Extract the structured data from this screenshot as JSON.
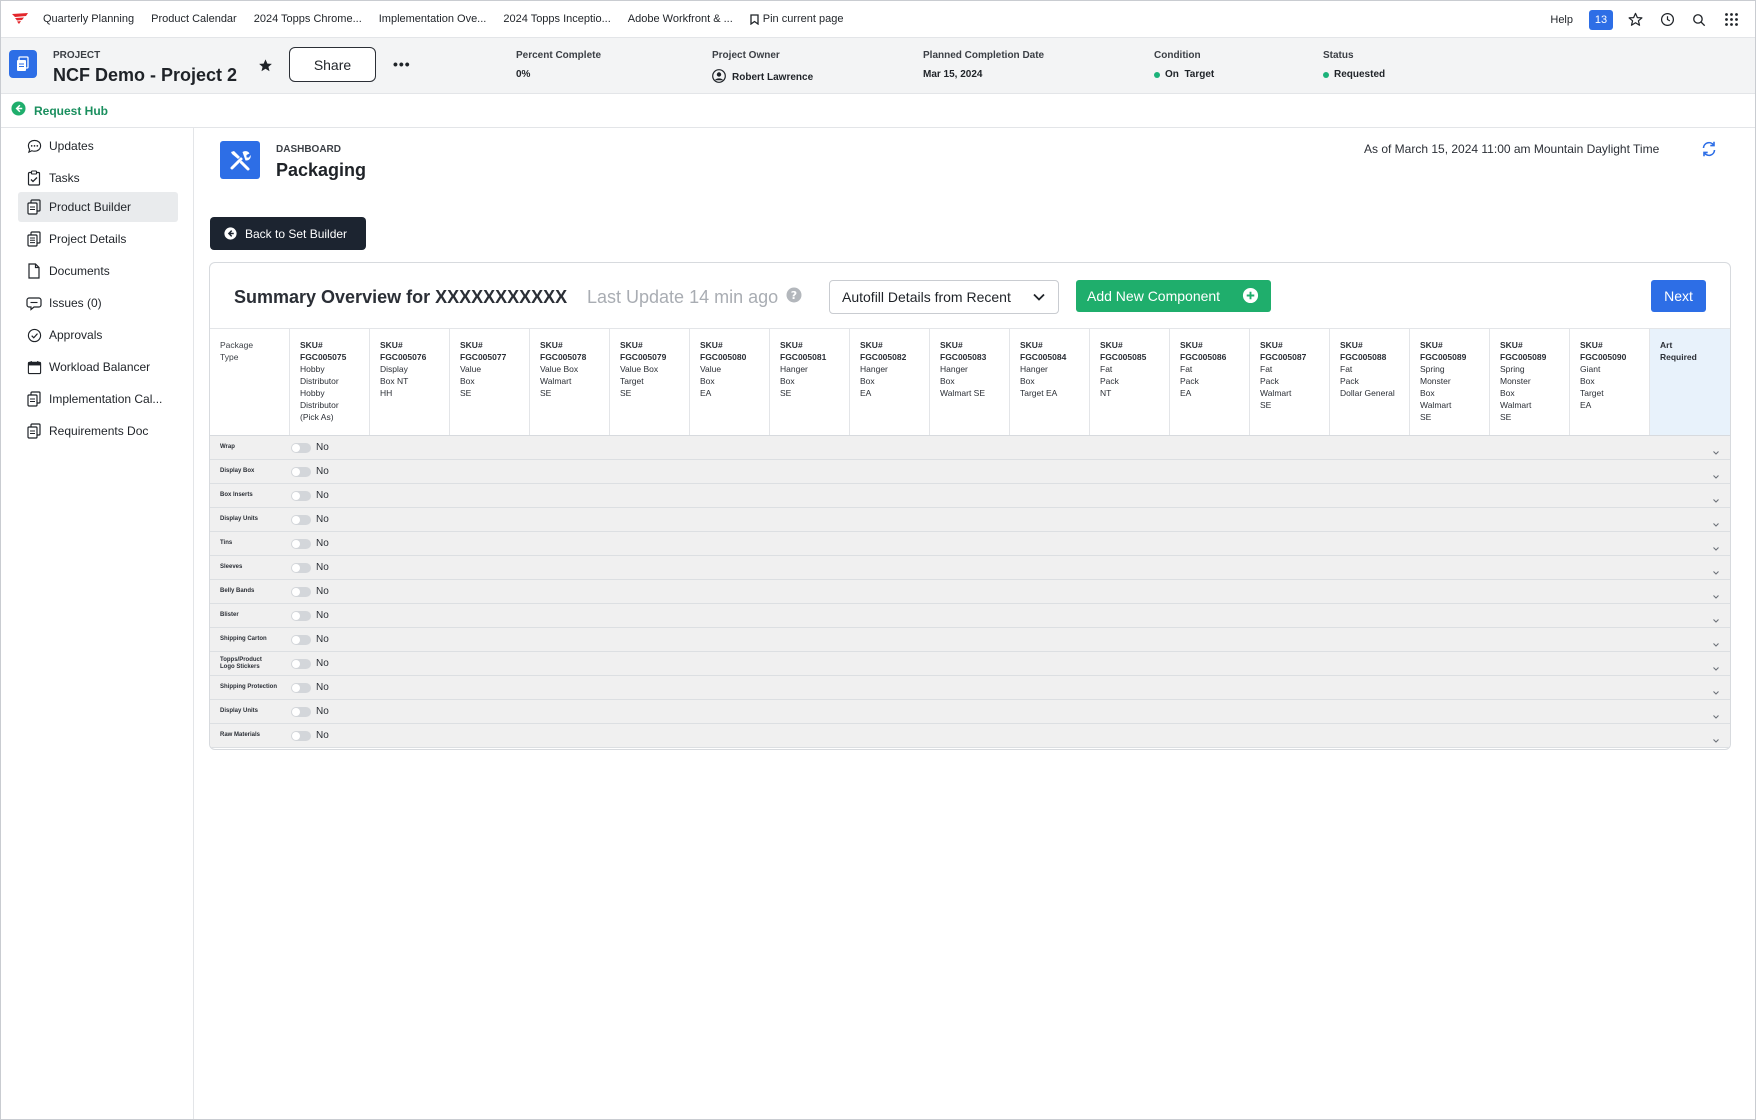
{
  "topbar": {
    "links": [
      "Quarterly Planning",
      "Product Calendar",
      "2024 Topps Chrome...",
      "Implementation Ove...",
      "2024 Topps Inceptio...",
      "Adobe Workfront & ..."
    ],
    "pin_label": "Pin current page",
    "help_label": "Help",
    "notification_count": "13"
  },
  "project": {
    "label": "PROJECT",
    "name": "NCF Demo - Project 2",
    "share_label": "Share",
    "more_label": "•••",
    "meta": {
      "percent_label": "Percent Complete",
      "percent_value": "0%",
      "owner_label": "Project Owner",
      "owner_value": "Robert Lawrence",
      "planned_label": "Planned Completion Date",
      "planned_value": "Mar 15, 2024",
      "condition_label": "Condition",
      "condition_value": "On  Target",
      "status_label": "Status",
      "status_value": "Requested"
    }
  },
  "hub": {
    "label": "Request Hub"
  },
  "sidebar": {
    "items": [
      {
        "label": "Updates",
        "icon": "chat-icon"
      },
      {
        "label": "Tasks",
        "icon": "clipboard-check-icon"
      },
      {
        "label": "Product Builder",
        "icon": "document-stack-icon",
        "active": true
      },
      {
        "label": "Project Details",
        "icon": "document-list-icon"
      },
      {
        "label": "Documents",
        "icon": "document-icon"
      },
      {
        "label": "Issues (0)",
        "icon": "issues-icon"
      },
      {
        "label": "Approvals",
        "icon": "check-circle-icon"
      },
      {
        "label": "Workload Balancer",
        "icon": "calendar-icon"
      },
      {
        "label": "Implementation Cal...",
        "icon": "document-stack-icon"
      },
      {
        "label": "Requirements Doc",
        "icon": "document-stack-icon"
      }
    ]
  },
  "dashboard": {
    "label": "DASHBOARD",
    "title": "Packaging",
    "as_of": "As of March 15, 2024 11:00 am Mountain Daylight Time"
  },
  "back_button": "Back to Set Builder",
  "summary": {
    "title": "Summary Overview for XXXXXXXXXXX",
    "last_update": "Last Update 14 min ago",
    "autofill_label": "Autofill Details from Recent",
    "add_component_label": "Add New Component",
    "next_label": "Next"
  },
  "table": {
    "first_header": "Package\nType",
    "art_header": "Art\nRequired",
    "columns": [
      {
        "sku": "SKU#\nFGC005075",
        "desc": "Hobby\nDistributor\nHobby\nDistributor\n(Pick As)"
      },
      {
        "sku": "SKU#\nFGC005076",
        "desc": "Display\nBox NT\nHH"
      },
      {
        "sku": "SKU#\nFGC005077",
        "desc": "Value\nBox\nSE"
      },
      {
        "sku": "SKU#\nFGC005078",
        "desc": "Value Box\nWalmart\nSE"
      },
      {
        "sku": "SKU#\nFGC005079",
        "desc": "Value Box\nTarget\nSE"
      },
      {
        "sku": "SKU#\nFGC005080",
        "desc": "Value\nBox\nEA"
      },
      {
        "sku": "SKU#\nFGC005081",
        "desc": "Hanger\nBox\nSE"
      },
      {
        "sku": "SKU#\nFGC005082",
        "desc": "Hanger\nBox\nEA"
      },
      {
        "sku": "SKU#\nFGC005083",
        "desc": "Hanger\nBox\nWalmart SE"
      },
      {
        "sku": "SKU#\nFGC005084",
        "desc": "Hanger\nBox\nTarget EA"
      },
      {
        "sku": "SKU#\nFGC005085",
        "desc": "Fat\nPack\nNT"
      },
      {
        "sku": "SKU#\nFGC005086",
        "desc": "Fat\nPack\nEA"
      },
      {
        "sku": "SKU#\nFGC005087",
        "desc": "Fat\nPack\nWalmart\nSE"
      },
      {
        "sku": "SKU#\nFGC005088",
        "desc": "Fat\nPack\nDollar General"
      },
      {
        "sku": "SKU#\nFGC005089",
        "desc": "Spring\nMonster\nBox\nWalmart\nSE"
      },
      {
        "sku": "SKU#\nFGC005089",
        "desc": "Spring\nMonster\nBox\nWalmart\nSE"
      },
      {
        "sku": "SKU#\nFGC005090",
        "desc": "Giant\nBox\nTarget\nEA"
      }
    ],
    "rows": [
      {
        "label": "Wrap",
        "value": "No"
      },
      {
        "label": "Display Box",
        "value": "No"
      },
      {
        "label": "Box Inserts",
        "value": "No"
      },
      {
        "label": "Display Units",
        "value": "No"
      },
      {
        "label": "Tins",
        "value": "No"
      },
      {
        "label": "Sleeves",
        "value": "No"
      },
      {
        "label": "Belly Bands",
        "value": "No"
      },
      {
        "label": "Blister",
        "value": "No"
      },
      {
        "label": "Shipping Carton",
        "value": "No"
      },
      {
        "label": "Topps/Product\nLogo Stickers",
        "value": "No"
      },
      {
        "label": "Shipping Protection",
        "value": "No"
      },
      {
        "label": "Display Units",
        "value": "No"
      },
      {
        "label": "Raw Materials",
        "value": "No"
      }
    ]
  },
  "colors": {
    "accent_blue": "#2d6ee6",
    "accent_green": "#1fae6c",
    "back_button_bg": "#1c2430",
    "status_dot": "#1bb27a"
  }
}
